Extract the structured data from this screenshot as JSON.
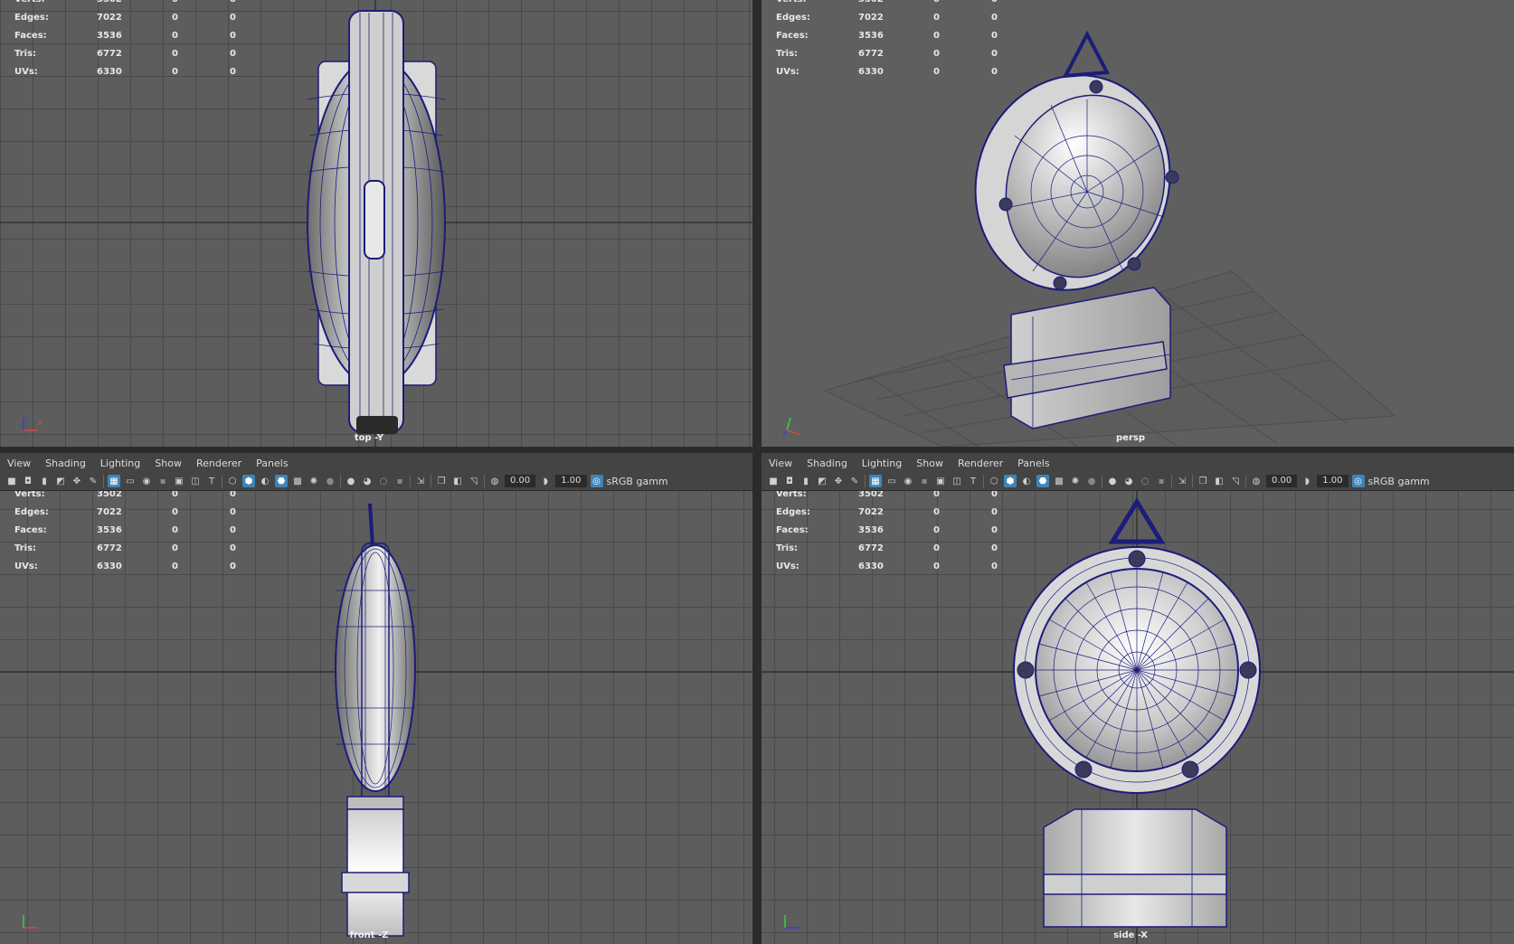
{
  "hud": {
    "labels": [
      "Verts:",
      "Edges:",
      "Faces:",
      "Tris:",
      "UVs:"
    ],
    "values": [
      [
        "3502",
        "0",
        "0"
      ],
      [
        "7022",
        "0",
        "0"
      ],
      [
        "3536",
        "0",
        "0"
      ],
      [
        "6772",
        "0",
        "0"
      ],
      [
        "6330",
        "0",
        "0"
      ]
    ]
  },
  "viewports": {
    "top": {
      "camera": "top -Y"
    },
    "persp": {
      "camera": "persp"
    },
    "front": {
      "camera": "front -Z"
    },
    "side": {
      "camera": "side -X"
    }
  },
  "panel_menu": [
    "View",
    "Shading",
    "Lighting",
    "Show",
    "Renderer",
    "Panels"
  ],
  "toolbar": {
    "exposure": "0.00",
    "gamma": "1.00",
    "color_space": "sRGB gamm"
  },
  "colors": {
    "viewport_bg": "#5d5d5d",
    "grid": "#4a4a4a",
    "wireframe": "#1c1c7a",
    "panel_bg": "#444444",
    "accent": "#3d85b8"
  },
  "icons": [
    "camera-icon",
    "grid-icon",
    "wireframe-icon",
    "smooth-shade-icon",
    "texture-icon",
    "light-icon",
    "isolate-icon"
  ]
}
